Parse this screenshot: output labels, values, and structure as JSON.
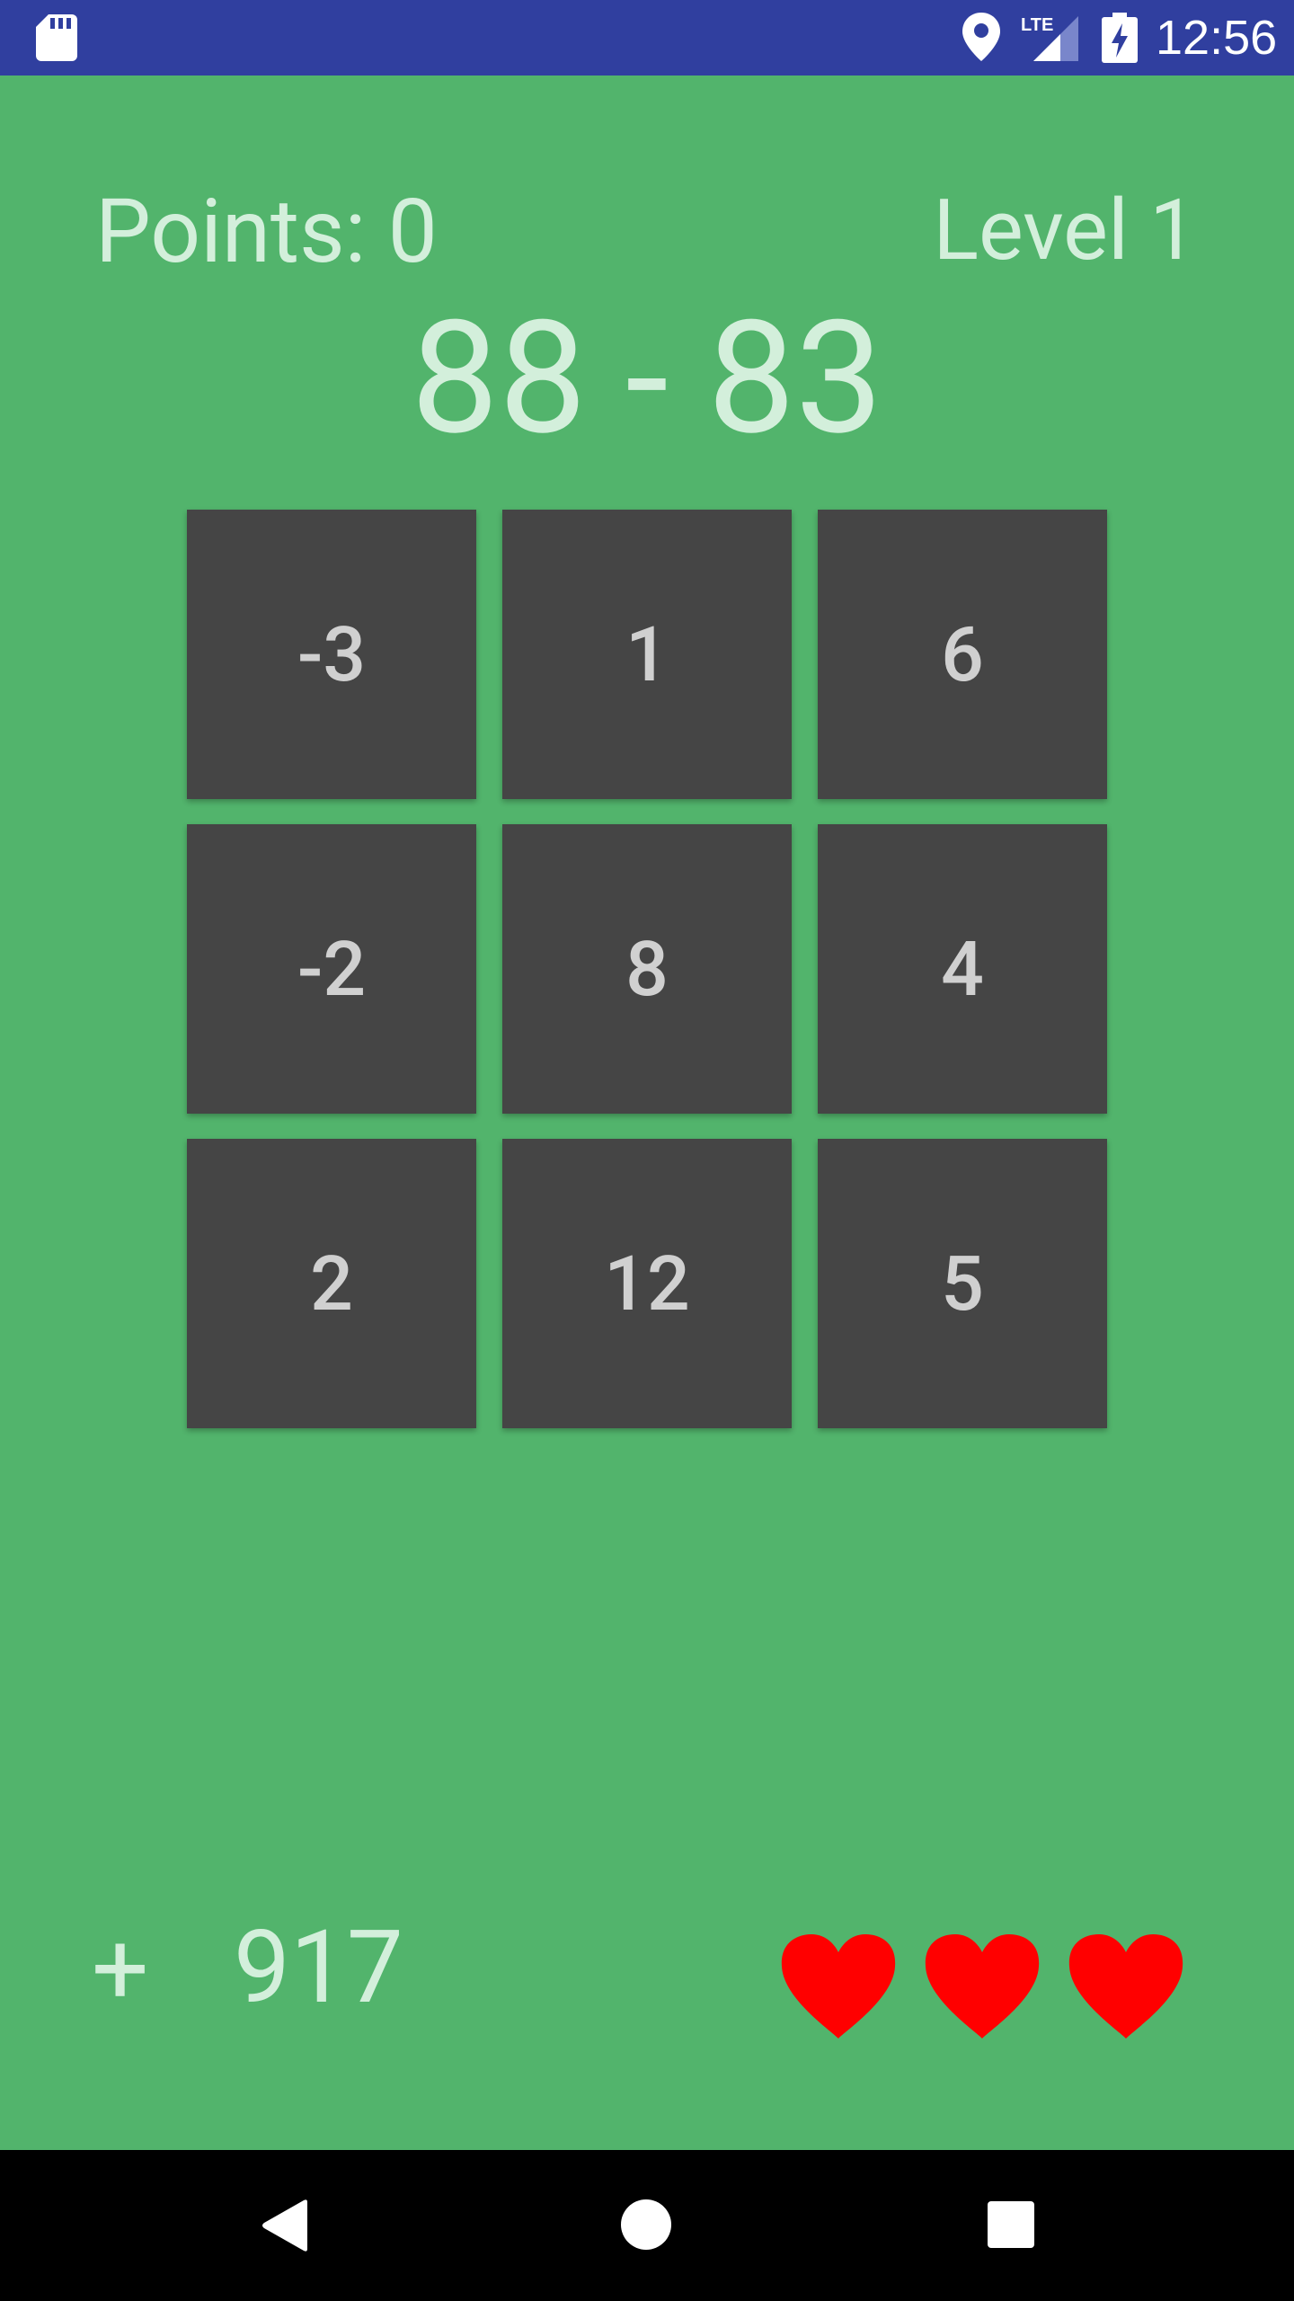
{
  "status_bar": {
    "time": "12:56",
    "icons": [
      "sd-card-icon",
      "location-icon",
      "lte-signal-icon",
      "battery-charging-icon"
    ],
    "lte_label": "LTE",
    "background_color": "#303f9f"
  },
  "game": {
    "points_label": "Points: 0",
    "level_label": "Level 1",
    "equation": "88 - 83",
    "background_color": "#52b46c",
    "text_color": "#d3efdb",
    "tile_color": "#454545",
    "tiles": [
      "-3",
      "1",
      "6",
      "-2",
      "8",
      "4",
      "2",
      "12",
      "5"
    ],
    "bonus_sign": "+",
    "bonus_value": "917",
    "lives": 3,
    "heart_color": "#ff0000"
  },
  "nav_bar": {
    "buttons": [
      "back-icon",
      "home-icon",
      "recents-icon"
    ]
  }
}
